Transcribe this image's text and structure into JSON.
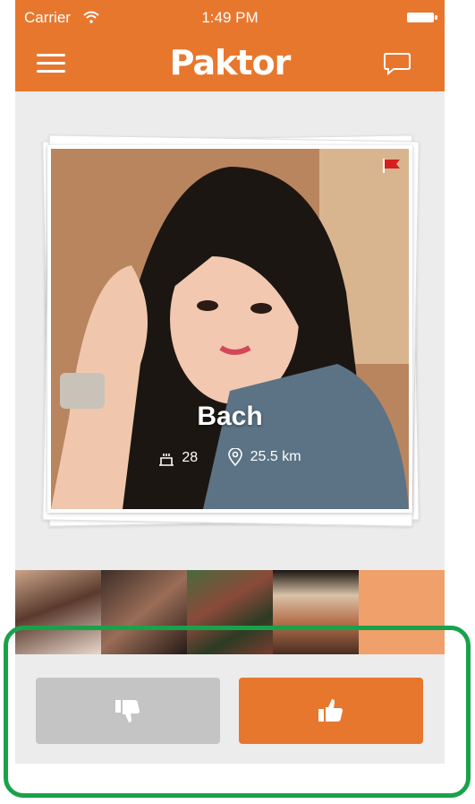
{
  "status_bar": {
    "carrier": "Carrier",
    "time": "1:49 PM"
  },
  "header": {
    "logo": "Paktor",
    "menu_icon": "hamburger-menu-icon",
    "chat_icon": "chat-bubble-icon"
  },
  "profile": {
    "name": "Bach",
    "age": "28",
    "distance": "25.5 km",
    "age_icon": "birthday-cake-icon",
    "distance_icon": "location-pin-icon",
    "flag_icon": "report-flag-icon"
  },
  "thumbnails_count": 5,
  "actions": {
    "dislike_icon": "thumbs-down-icon",
    "like_icon": "thumbs-up-icon"
  },
  "colors": {
    "brand": "#e8772e",
    "dislike": "#c4c4c4",
    "highlight": "#19a24a"
  }
}
